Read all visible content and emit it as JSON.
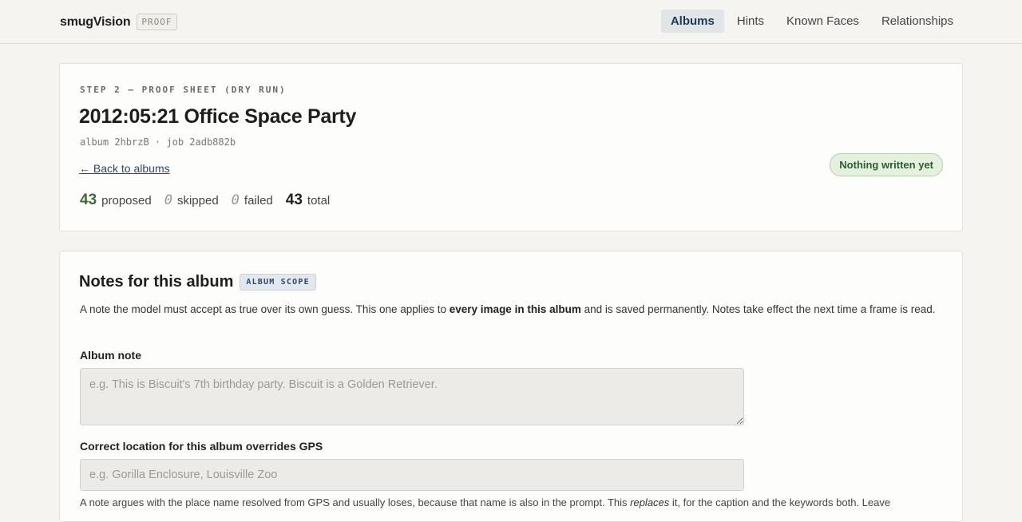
{
  "brand": {
    "name": "smugVision",
    "badge": "PROOF"
  },
  "nav": {
    "items": [
      {
        "label": "Albums",
        "active": true
      },
      {
        "label": "Hints",
        "active": false
      },
      {
        "label": "Known Faces",
        "active": false
      },
      {
        "label": "Relationships",
        "active": false
      }
    ]
  },
  "summary": {
    "step": "STEP 2 — PROOF SHEET (DRY RUN)",
    "title": "2012:05:21 Office Space Party",
    "meta": "album 2hbrzB · job 2adb882b",
    "back_label": "← Back to albums",
    "status": "Nothing written yet",
    "stats": {
      "proposed": {
        "value": "43",
        "label": "proposed"
      },
      "skipped": {
        "value": "0",
        "label": "skipped"
      },
      "failed": {
        "value": "0",
        "label": "failed"
      },
      "total": {
        "value": "43",
        "label": "total"
      }
    }
  },
  "notes": {
    "title": "Notes for this album",
    "scope_badge": "ALBUM SCOPE",
    "desc_pre": "A note the model must accept as true over its own guess. This one applies to ",
    "desc_bold": "every image in this album",
    "desc_post": " and is saved permanently. Notes take effect the next time a frame is read.",
    "album_note_label": "Album note",
    "album_note_placeholder": "e.g. This is Biscuit's 7th birthday party. Biscuit is a Golden Retriever.",
    "location_label": "Correct location for this album overrides GPS",
    "location_placeholder": "e.g. Gorilla Enclosure, Louisville Zoo",
    "footnote_pre": "A note argues with the place name resolved from GPS and usually loses, because that name is also in the prompt. This ",
    "footnote_em": "replaces",
    "footnote_post": " it, for the caption and the keywords both. Leave"
  },
  "colors": {
    "background": "#f5f4f1",
    "card": "#fdfdfb",
    "accent": "#2a4a6b",
    "proposed_green": "#3f6b3a",
    "status_bg": "#e6f0de"
  }
}
